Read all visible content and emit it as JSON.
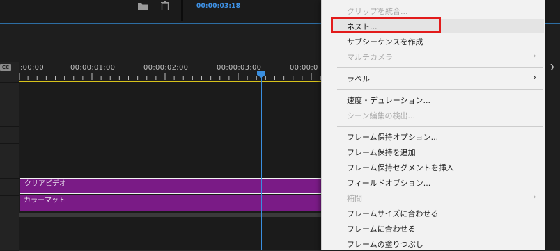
{
  "header": {
    "timecode": "00:00:03:18"
  },
  "timeline": {
    "cc_label": "CC",
    "ruler_labels": [
      ":00:00",
      "00:00:01:00",
      "00:00:02:00",
      "00:00:03:00",
      "00:00:0"
    ],
    "clips": [
      "クリアビデオ",
      "カラーマット"
    ]
  },
  "context_menu": {
    "items": {
      "clip_merge": "クリップを統合...",
      "nest": "ネスト...",
      "make_subsequence": "サブシーケンスを作成",
      "multicam": "マルチカメラ",
      "label": "ラベル",
      "speed_duration": "速度・デュレーション...",
      "scene_detect": "シーン編集の検出...",
      "frame_hold_options": "フレーム保持オプション...",
      "add_frame_hold": "フレーム保持を追加",
      "insert_frame_hold_segment": "フレーム保持セグメントを挿入",
      "field_options": "フィールドオプション...",
      "interpolation": "補間",
      "scale_to_frame_size": "フレームサイズに合わせる",
      "set_to_frame_size": "フレームに合わせる",
      "frame_fill": "フレームの塗りつぶし"
    },
    "highlighted": "nest",
    "disabled": [
      "clip_merge",
      "multicam",
      "scene_detect",
      "interpolation"
    ]
  },
  "colors": {
    "accent": "#3f93e8",
    "clip": "#7a1b86",
    "highlight_box": "#e21b1b",
    "ruler_bar": "#d6c21b"
  },
  "icons": [
    "folder-icon",
    "trash-icon",
    "playhead-icon",
    "chevron-right-icon"
  ]
}
